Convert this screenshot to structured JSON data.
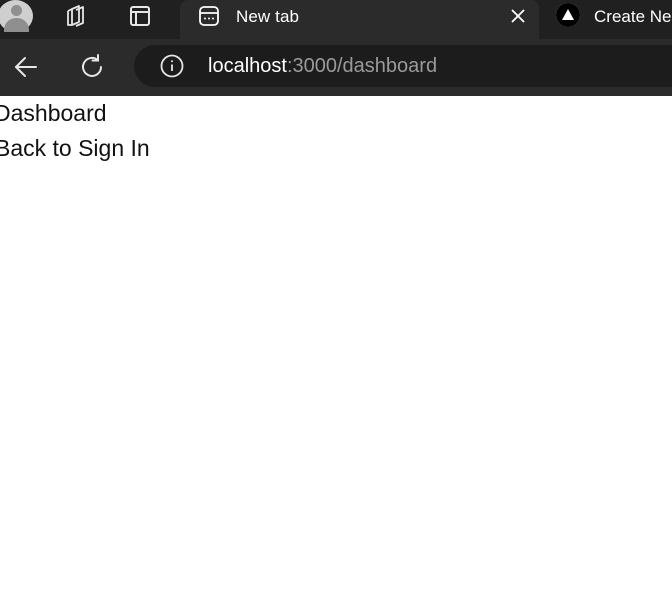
{
  "browser": {
    "tabs": [
      {
        "title": "New tab",
        "active": true,
        "favicon": "new-tab-grid-icon"
      },
      {
        "title": "Create Ne",
        "active": false,
        "favicon": "vercel-triangle-icon"
      }
    ],
    "toolbar_icons": [
      "profile-avatar-icon",
      "workspaces-icon",
      "tab-actions-icon"
    ],
    "nav_icons": [
      "back-arrow-icon",
      "reload-icon"
    ],
    "address": {
      "info_icon": "site-info-icon",
      "host": "localhost",
      "path": ":3000/dashboard"
    },
    "colors": {
      "tabstrip": "#202020",
      "toolbar": "#2b2b2b",
      "address_bg": "#1c1c1c",
      "path_gray": "#9a9a9a"
    }
  },
  "page": {
    "heading": "Dashboard",
    "link_text": "Back to Sign In"
  }
}
